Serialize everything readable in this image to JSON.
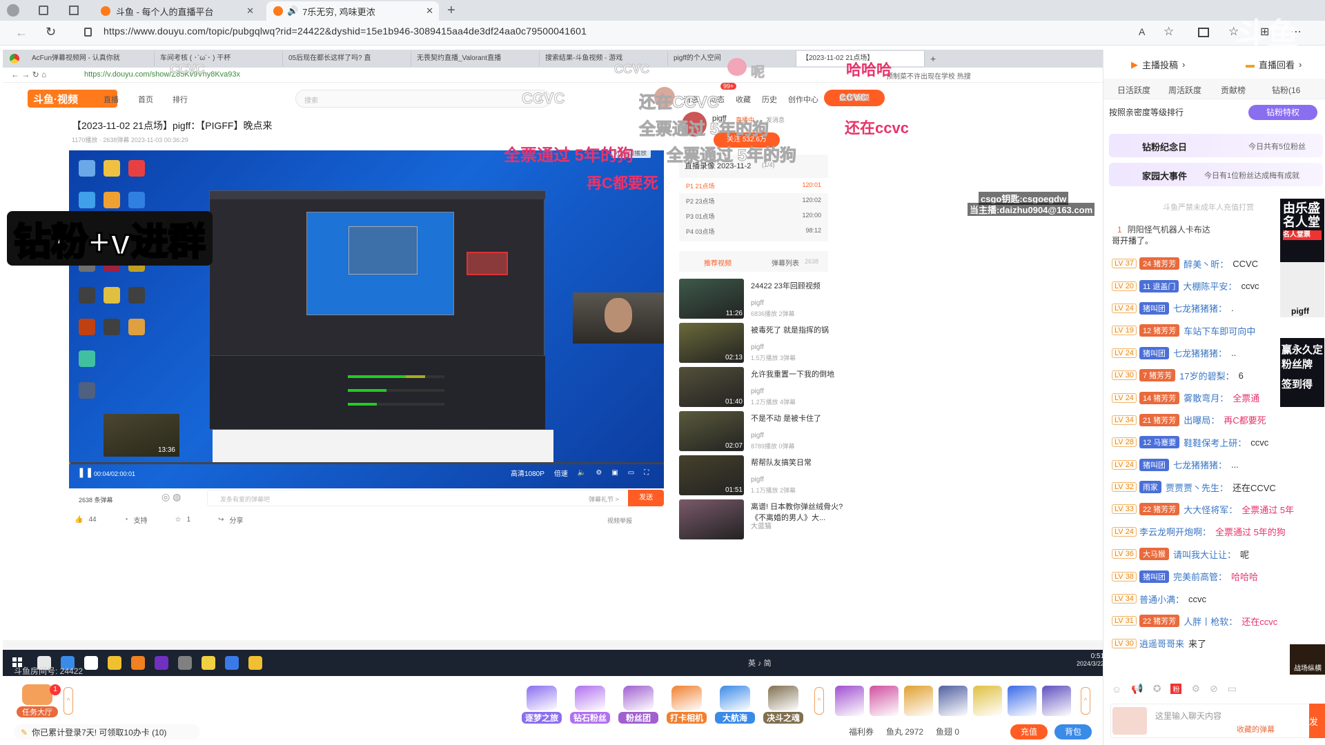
{
  "browser": {
    "tabs": [
      {
        "title": "斗鱼 - 每个人的直播平台"
      },
      {
        "title": "7乐无穷, 鸡味更浓"
      }
    ],
    "url": "https://www.douyu.com/topic/pubgqlwq?rid=24422&dyshid=15e1b946-3089415aa4de3df24aa0c79500041601"
  },
  "inner_browser": {
    "tabs": [
      "AcFun弹幕视频网 - 认真你就",
      "车间考核 ( ･`ω´･ ) 干杯",
      "05后现在都长这样了吗? 直",
      "无畏契约直播_Valorant直播",
      "搜索结果-斗鱼视频 - 游戏",
      "pigff的个人空间",
      "【2023-11-02 21点场】"
    ],
    "url": "https://v.douyu.com/show/Z85Kv9Vhy8Kva93x",
    "search_hint": "预制菜不许出现在学校 热搜"
  },
  "vod": {
    "nav": [
      "直播",
      "首页",
      "排行"
    ],
    "search_placeholder": "搜索",
    "header_actions": [
      "消息",
      "动态",
      "收藏",
      "历史",
      "创作中心"
    ],
    "msg_badge": "99+",
    "upload_label": "上传视频",
    "title": "【2023-11-02 21点场】pigff：【PIGFF】晚点来",
    "meta": "1170播放 · 2638弹幕   2023-11-03 00:36:29",
    "mini_window": "小窗口播放",
    "time": "00:04/02:00:01",
    "quality": "高清1080P",
    "speed": "倍速",
    "danmaku_count": "2638 条弹幕",
    "danmaku_placeholder": "发条有爱的弹幕吧",
    "danmaku_rules": "弹幕礼节 >",
    "send_label": "发送",
    "likes": "44",
    "support": "支持",
    "fav": "1",
    "share": "分享",
    "report": "视频举报",
    "uploader": "pigff",
    "uploader_tag1": "直播中",
    "uploader_tag2": "发消息",
    "follow": "关注 532.6万",
    "playlist_title": "直播录像 2023-11-2",
    "playlist_count": "(1/4)",
    "playlist": [
      {
        "name": "P1 21点场",
        "dur": "120:01"
      },
      {
        "name": "P2 23点场",
        "dur": "120:02"
      },
      {
        "name": "P3 01点场",
        "dur": "120:00"
      },
      {
        "name": "P4 03点场",
        "dur": "98:12"
      }
    ],
    "tab_recommend": "推荐视频",
    "tab_danmaku": "弹幕列表",
    "tab_danmaku_count": "2638",
    "recommend": [
      {
        "title": "24422 23年回顾视频",
        "author": "pigff",
        "stats": "6836播放  2弹幕",
        "dur": "11:26",
        "color": "#3d5a4a"
      },
      {
        "title": "被毒死了 就是指挥的锅",
        "author": "pigff",
        "stats": "1.5万播放  3弹幕",
        "dur": "02:13",
        "color": "#6b6a3a"
      },
      {
        "title": "允许我重置一下我的倒地",
        "author": "pigff",
        "stats": "1.2万播放  4弹幕",
        "dur": "01:40",
        "color": "#54503a"
      },
      {
        "title": "不是不动 是被卡住了",
        "author": "pigff",
        "stats": "8789播放  0弹幕",
        "dur": "02:07",
        "color": "#5a5a3c"
      },
      {
        "title": "帮帮队友搞笑日常",
        "author": "pigff",
        "stats": "1.1万播放  2弹幕",
        "dur": "01:51",
        "color": "#46412c"
      },
      {
        "title": "离谱! 日本教你弹丝绒骨火? 《不离婚的男人》大...",
        "author": "大蓝猫",
        "stats": "",
        "dur": "",
        "color": "#7a5a6a"
      }
    ]
  },
  "overlays": {
    "zuanfen": "钻粉+v进群",
    "quanpiao1": "全票通过 5年的狗",
    "quanpiao2": "全票通过 5年的狗",
    "quanpiao3": "全票通过 5年的狗",
    "zaic": "再C都要死",
    "haihai": "哈哈哈",
    "ccvc1": "CCVC",
    "ccvc2": "CCVC",
    "ccvc3": "ccvc",
    "ccvc4": "ccvc",
    "ccvc5": "CCVC",
    "hai_ccvc": "还在CCVC",
    "hai_ccvc2": "还在ccvc",
    "ni": "呢",
    "csgo1": "csgo钥匙:csgoegdw",
    "csgo2": "当主播:daizhu0904@163.com"
  },
  "stream_bottom": {
    "room_no": "斗鱼房间号: 24422",
    "task_label": "任务大厅",
    "task_badge": "1",
    "gifts": [
      "逐梦之旅",
      "钻石粉丝",
      "粉丝团",
      "打卡相机",
      "大航海",
      "决斗之魂"
    ],
    "login_notice": "你已累计登录7天! 可领取10办卡 (10)",
    "welfare": "福利券",
    "fish_wan": "鱼丸 2972",
    "fish_chi": "鱼翅 0",
    "recharge": "充值",
    "bag": "背包"
  },
  "taskbar": {
    "time": "0:51",
    "date": "2024/3/22",
    "tray": "英 ♪ 简"
  },
  "chat": {
    "top_tabs": [
      "主播投稿",
      "直播回看"
    ],
    "rank_tabs": [
      "日活跃度",
      "周活跃度",
      "贡献榜",
      "钻粉(16"
    ],
    "sort_label": "按照亲密度等级排行",
    "diamond_btn": "钻粉特权",
    "anniversary": "钻粉纪念日",
    "anniversary_info": "今日共有5位粉丝",
    "family_event": "家园大事件",
    "family_info": "今日有1位粉丝达成梅有成就",
    "notice": "斗鱼严禁未成年人充值打赏",
    "broadcast": "阴阳怪气机器人卡布达",
    "first_line": "哥开播了。",
    "messages": [
      {
        "lv": "LV 37",
        "fan": "24",
        "club": "猪芳芳",
        "user": "醉美丶昕：",
        "text": "CCVC"
      },
      {
        "lv": "LV 20",
        "fan": "11",
        "club": "退盖门",
        "user": "大棚陈平安：",
        "text": "ccvc"
      },
      {
        "lv": "LV 24",
        "fan": "",
        "club": "猪叫团",
        "user": "七龙猪猪猪：",
        "text": "."
      },
      {
        "lv": "LV 19",
        "fan": "12",
        "club": "猪芳芳",
        "user": "车站下车即可向中",
        "text": ""
      },
      {
        "lv": "LV 24",
        "fan": "",
        "club": "猪叫团",
        "user": "七龙猪猪猪：",
        "text": ".."
      },
      {
        "lv": "LV 30",
        "fan": "7",
        "club": "猪芳芳",
        "user": "17岁的碧梨：",
        "text": "6"
      },
      {
        "lv": "LV 24",
        "fan": "14",
        "club": "猪芳芳",
        "user": "雾散弯月：",
        "text": "全票通"
      },
      {
        "lv": "LV 34",
        "fan": "21",
        "club": "猪芳芳",
        "user": "出曝局：",
        "text": "再C都要死"
      },
      {
        "lv": "LV 28",
        "fan": "12",
        "club": "马蹇要",
        "user": "鞋鞋保考上研：",
        "text": "ccvc"
      },
      {
        "lv": "LV 24",
        "fan": "",
        "club": "猪叫团",
        "user": "七龙猪猪猪：",
        "text": "..."
      },
      {
        "lv": "LV 32",
        "fan": "",
        "club": "雨家",
        "user": "贾贾贾丶先生：",
        "text": "还在CCVC"
      },
      {
        "lv": "LV 33",
        "fan": "22",
        "club": "猪芳芳",
        "user": "大大怪将军：",
        "text": "全票通过 5年"
      },
      {
        "lv": "LV 24",
        "fan": "",
        "club": "",
        "user": "李云龙啊开炮啊：",
        "text": "全票通过 5年的狗"
      },
      {
        "lv": "LV 36",
        "fan": "",
        "club": "大马猴",
        "user": "请叫我大让让：",
        "text": "呢"
      },
      {
        "lv": "LV 38",
        "fan": "",
        "club": "猪叫团",
        "user": "完美前高管：",
        "text": "哈哈哈"
      },
      {
        "lv": "LV 34",
        "fan": "",
        "club": "",
        "user": "普通小满：",
        "text": "ccvc"
      },
      {
        "lv": "LV 31",
        "fan": "22",
        "club": "猪芳芳",
        "user": "人胖丨枪软：",
        "text": "还在ccvc"
      },
      {
        "lv": "LV 30",
        "fan": "",
        "club": "",
        "user": "逍遥哥哥来",
        "text": "来了"
      }
    ],
    "input_placeholder": "这里输入聊天内容",
    "input_hint": "收藏的弹幕",
    "send": "发",
    "side_promo1": "由乐盛名人堂",
    "side_promo1_sub": "名人堂票",
    "side_promo2_name": "pigff",
    "side_promo3": "赢永久定粉丝牌",
    "side_promo4": "签到得",
    "side_promo5": "战场纵横"
  },
  "colors": {
    "accent": "#ff5d23",
    "overlay_red": "#e8336b",
    "chat_blue": "#3a76c4",
    "level_orange": "#e88a1a"
  }
}
